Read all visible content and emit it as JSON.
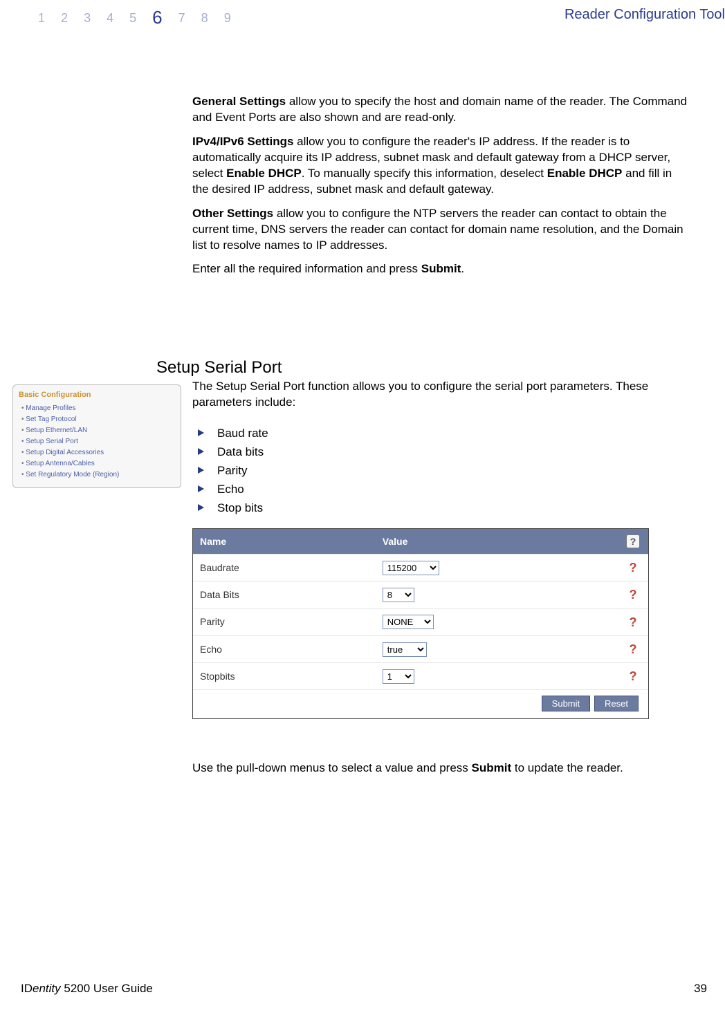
{
  "header": {
    "nav": [
      "1",
      "2",
      "3",
      "4",
      "5",
      "6",
      "7",
      "8",
      "9"
    ],
    "active_index": 5,
    "title": "Reader Configuration Tool"
  },
  "body": {
    "p1_b": "General Settings",
    "p1_rest": " allow you to specify the host and domain name of the reader. The Command and Event Ports are also shown and are read-only.",
    "p2_b": "IPv4/IPv6 Settings",
    "p2_mid1": " allow you to configure the reader's IP address. If the reader is to automatically acquire its IP address, subnet mask and default gateway from a DHCP server, select ",
    "p2_b2": "Enable DHCP",
    "p2_mid2": ". To manually specify this information, deselect ",
    "p2_b3": "Enable DHCP",
    "p2_end": " and fill in the desired IP address, subnet mask and default gateway.",
    "p3_b": "Other Settings",
    "p3_rest": " allow you to configure the NTP servers the reader can contact to obtain the current time, DNS servers the reader can contact for domain name resolution, and the Domain list to resolve names to IP addresses.",
    "p4_pre": "Enter all the required information and press ",
    "p4_b": "Submit",
    "p4_post": "."
  },
  "section": {
    "heading": "Setup Serial Port",
    "intro": "The Setup Serial Port function allows you to configure the serial port parameters. These parameters include:",
    "list": [
      "Baud rate",
      "Data bits",
      "Parity",
      "Echo",
      "Stop bits"
    ],
    "closing_pre": "Use the pull-down menus to select a value and press ",
    "closing_b": "Submit",
    "closing_post": " to update the reader."
  },
  "sidebar": {
    "title": "Basic Configuration",
    "items": [
      "Manage Profiles",
      "Set Tag Protocol",
      "Setup Ethernet/LAN",
      "Setup Serial Port",
      "Setup Digital Accessories",
      "Setup Antenna/Cables",
      "Set Regulatory Mode (Region)"
    ]
  },
  "form": {
    "head": {
      "name": "Name",
      "value": "Value",
      "help": "?"
    },
    "rows": [
      {
        "label": "Baudrate",
        "value": "115200"
      },
      {
        "label": "Data Bits",
        "value": "8"
      },
      {
        "label": "Parity",
        "value": "NONE"
      },
      {
        "label": "Echo",
        "value": "true"
      },
      {
        "label": "Stopbits",
        "value": "1"
      }
    ],
    "help_glyph": "?",
    "submit": "Submit",
    "reset": "Reset"
  },
  "footer": {
    "left_pre": "ID",
    "left_i": "entity",
    "left_post": " 5200 User Guide",
    "page": "39"
  }
}
